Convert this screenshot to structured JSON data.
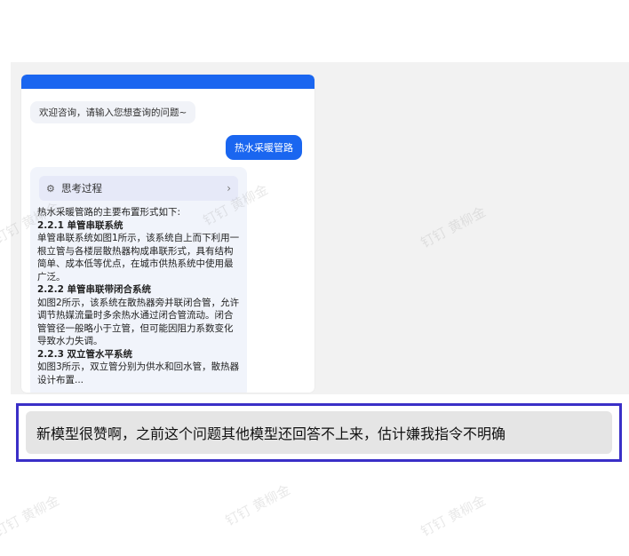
{
  "chat": {
    "welcome": "欢迎咨询，请输入您想查询的问题~",
    "user_message": "热水采暖管路",
    "thinking_label": "思考过程",
    "thinking_icon": "thinking-icon",
    "answer_intro": "热水采暖管路的主要布置形式如下:",
    "sections": [
      {
        "title": "2.2.1 单管串联系统",
        "text": "单管串联系统如图1所示，该系统自上而下利用一根立管与各楼层散热器构成串联形式，具有结构简单、成本低等优点，在城市供热系统中使用最广泛。"
      },
      {
        "title": "2.2.2 单管串联带闭合系统",
        "text": "如图2所示，该系统在散热器旁并联闭合管，允许调节热媒流量时多余热水通过闭合管流动。闭合管管径一般略小于立管，但可能因阻力系数变化导致水力失调。"
      },
      {
        "title": "2.2.3 双立管水平系统",
        "text": "如图3所示，双立管分别为供水和回水管，散热器设计布置..."
      }
    ]
  },
  "feedback": {
    "text": "新模型很赞啊，之前这个问题其他模型还回答不上来，估计嫌我指令不明确"
  },
  "watermark": "钉钉 黄柳金",
  "colors": {
    "accent": "#1a66f0",
    "highlight_border": "#3a2fc7"
  }
}
